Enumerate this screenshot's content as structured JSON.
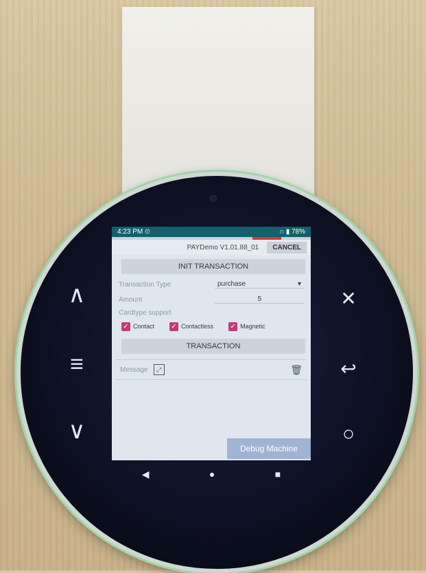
{
  "status_bar": {
    "time": "4:23 PM",
    "alarm_icon": "alarm-icon",
    "battery": "78%"
  },
  "header": {
    "version": "PAYDemo V1.01.88_01",
    "cancel_label": "CANCEL"
  },
  "init_section": {
    "label": "INIT TRANSACTION"
  },
  "form": {
    "transaction_type_label": "Transaction Type",
    "transaction_type_value": "purchase",
    "amount_label": "Amount",
    "amount_value": "5",
    "cardtype_label": "Cardtype support",
    "checkboxes": [
      {
        "label": "Contact",
        "checked": true
      },
      {
        "label": "Contactless",
        "checked": true
      },
      {
        "label": "Magnetic",
        "checked": true
      }
    ]
  },
  "transaction_section": {
    "label": "TRANSACTION"
  },
  "message": {
    "label": "Message"
  },
  "debug_button": {
    "label": "Debug Machine"
  },
  "nav": {
    "back": "◀",
    "home": "●",
    "recent": "■"
  },
  "side_buttons": {
    "up": "∧",
    "menu": "≡",
    "down": "∨",
    "close": "✕",
    "return": "↩",
    "ok": "○"
  },
  "colors": {
    "status_bar": "#12616b",
    "checkbox": "#c23b7a",
    "debug_button": "#9fb3d2"
  }
}
